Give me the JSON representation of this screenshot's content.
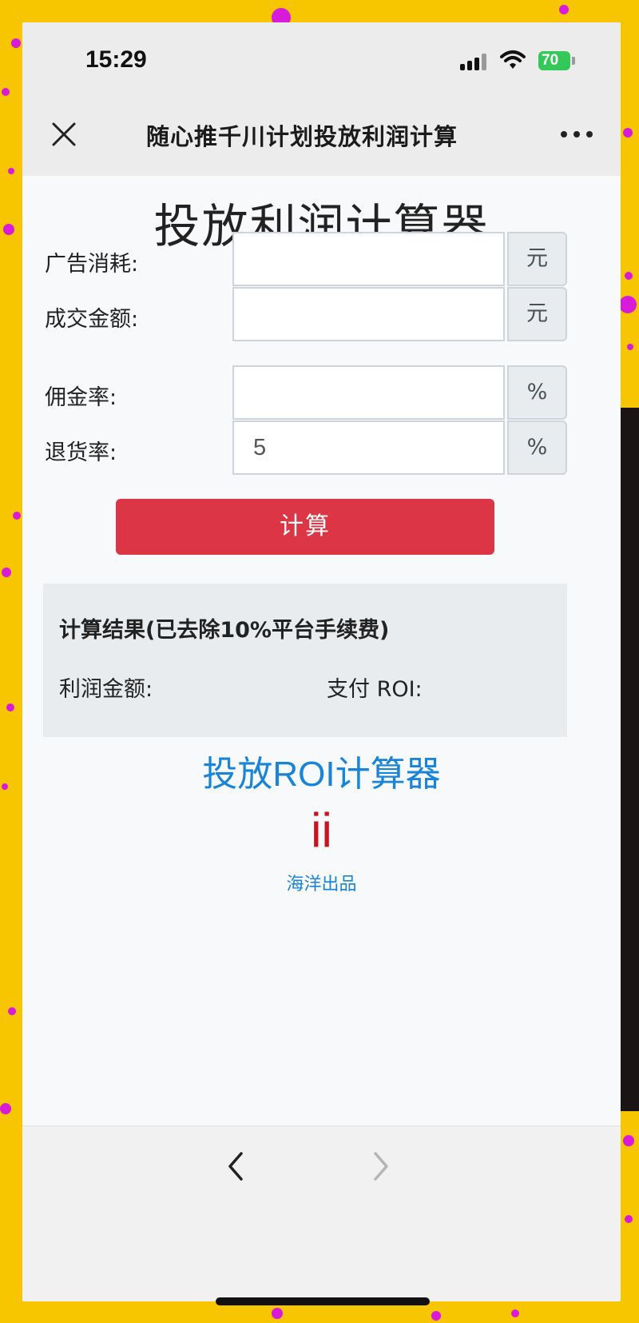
{
  "status_bar": {
    "time": "15:29",
    "battery": "70",
    "icons": [
      "signal-icon",
      "wifi-icon",
      "battery-icon"
    ]
  },
  "nav_bar": {
    "title": "随心推千川计划投放利润计算",
    "left_icon": "close-icon",
    "right_icon": "more-icon"
  },
  "page": {
    "title": "投放利润计算器"
  },
  "form": {
    "ad_spend": {
      "label": "广告消耗:",
      "value": "",
      "unit": "元"
    },
    "deal_amount": {
      "label": "成交金额:",
      "value": "",
      "unit": "元"
    },
    "commission_rate": {
      "label": "佣金率:",
      "value": "",
      "unit": "%"
    },
    "return_rate": {
      "label": "退货率:",
      "value": "5",
      "unit": "%"
    },
    "submit_label": "计算"
  },
  "result": {
    "title": "计算结果(已去除10%平台手续费)",
    "profit_label": "利润金额:",
    "roi_label": "支付 ROI:"
  },
  "footer": {
    "roi_link": "投放ROI计算器",
    "logo": "ii",
    "credit": "海洋出品"
  },
  "bottom_nav": {
    "back_icon": "chevron-left-icon",
    "forward_icon": "chevron-right-icon"
  },
  "colors": {
    "background": "#f8c600",
    "dots": "#d81bd8",
    "button": "#dc3545",
    "link": "#1a84d8",
    "logo": "#c8141e"
  }
}
